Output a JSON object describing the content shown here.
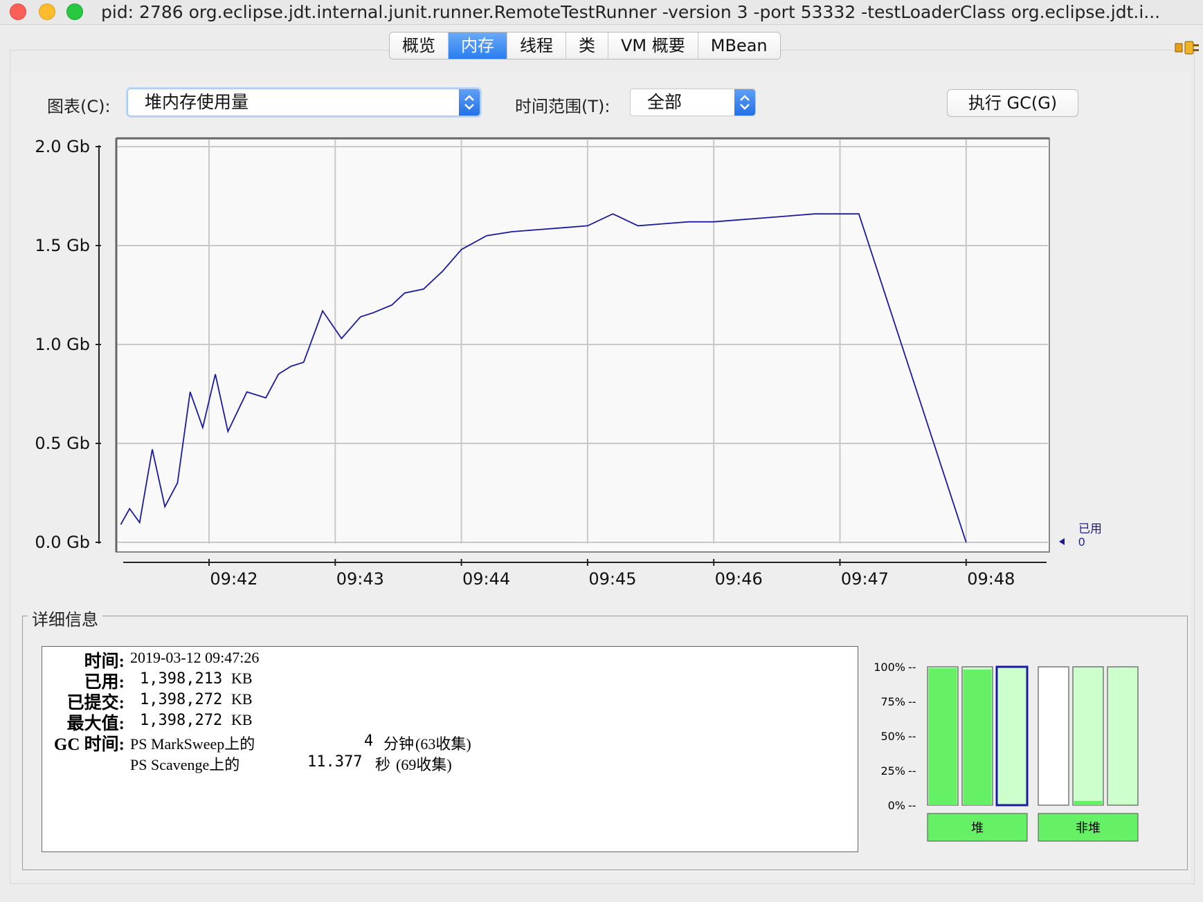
{
  "window": {
    "title": "pid: 2786 org.eclipse.jdt.internal.junit.runner.RemoteTestRunner -version 3 -port 53332 -testLoaderClass org.eclipse.jdt.i..."
  },
  "tabs": [
    {
      "label": "概览",
      "active": false
    },
    {
      "label": "内存",
      "active": true
    },
    {
      "label": "线程",
      "active": false
    },
    {
      "label": "类",
      "active": false
    },
    {
      "label": "VM 概要",
      "active": false
    },
    {
      "label": "MBean",
      "active": false
    }
  ],
  "controls": {
    "chart_label": "图表(C):",
    "chart_select_value": "堆内存使用量",
    "time_range_label": "时间范围(T):",
    "time_range_value": "全部",
    "gc_button": "执行 GC(G)"
  },
  "colors": {
    "line": "#1a1aa0",
    "active_tab": "#2a7ef0",
    "bar_green": "#66f066",
    "bar_light": "#ccffcc"
  },
  "chart_data": {
    "type": "line",
    "ylabel": "",
    "xlabel": "",
    "yticks": [
      "2.0 Gb",
      "1.5 Gb",
      "1.0 Gb",
      "0.5 Gb",
      "0.0 Gb"
    ],
    "ylim": [
      0,
      2.0
    ],
    "xticks": [
      "09:42",
      "09:43",
      "09:44",
      "09:45",
      "09:46",
      "09:47",
      "09:48"
    ],
    "xlim_minutes": [
      9.69,
      9.7
    ],
    "series": [
      {
        "name": "已用",
        "current_value": "0",
        "x_minutes": [
          41.3,
          41.37,
          41.45,
          41.55,
          41.65,
          41.75,
          41.85,
          41.95,
          42.05,
          42.15,
          42.3,
          42.45,
          42.55,
          42.65,
          42.75,
          42.9,
          43.05,
          43.2,
          43.3,
          43.45,
          43.55,
          43.7,
          43.85,
          44.0,
          44.2,
          44.4,
          44.6,
          44.8,
          45.0,
          45.2,
          45.4,
          45.6,
          45.8,
          46.0,
          46.2,
          46.4,
          46.6,
          46.8,
          47.0,
          47.15,
          48.0
        ],
        "y_gb": [
          0.09,
          0.17,
          0.1,
          0.47,
          0.18,
          0.3,
          0.76,
          0.58,
          0.85,
          0.56,
          0.76,
          0.73,
          0.85,
          0.89,
          0.91,
          1.17,
          1.03,
          1.14,
          1.16,
          1.2,
          1.26,
          1.28,
          1.37,
          1.48,
          1.55,
          1.57,
          1.58,
          1.59,
          1.6,
          1.66,
          1.6,
          1.61,
          1.62,
          1.62,
          1.63,
          1.64,
          1.65,
          1.66,
          1.66,
          1.66,
          0.0
        ]
      }
    ]
  },
  "details": {
    "title": "详细信息",
    "time_label": "时间:",
    "time_value": "2019-03-12 09:47:26",
    "used_label": "已用:",
    "used_value": "1,398,213",
    "used_unit": "KB",
    "committed_label": "已提交:",
    "committed_value": "1,398,272",
    "committed_unit": "KB",
    "max_label": "最大值:",
    "max_value": "1,398,272",
    "max_unit": "KB",
    "gc_label": "GC 时间:",
    "gc1_name": "PS MarkSweep上的",
    "gc1_time": "4",
    "gc1_unit": "分钟",
    "gc1_count": "(63收集)",
    "gc2_name": "PS Scavenge上的",
    "gc2_time": "11.377",
    "gc2_unit": "秒",
    "gc2_count": "(69收集)"
  },
  "pools": {
    "yticks": [
      "100%",
      "75%",
      "50%",
      "25%",
      "0%"
    ],
    "heap_label": "堆",
    "nonheap_label": "非堆",
    "bars": [
      {
        "group": "heap",
        "fill": 0.99,
        "color": "green",
        "selected": false
      },
      {
        "group": "heap",
        "fill": 0.98,
        "color": "green",
        "selected": false
      },
      {
        "group": "heap",
        "fill": 1.0,
        "color": "light",
        "selected": true
      },
      {
        "group": "nonheap",
        "fill": 0.0,
        "color": "light",
        "selected": false
      },
      {
        "group": "nonheap",
        "fill": 0.03,
        "color": "green",
        "selected": false
      },
      {
        "group": "nonheap",
        "fill": 1.0,
        "color": "light",
        "selected": false
      }
    ]
  }
}
